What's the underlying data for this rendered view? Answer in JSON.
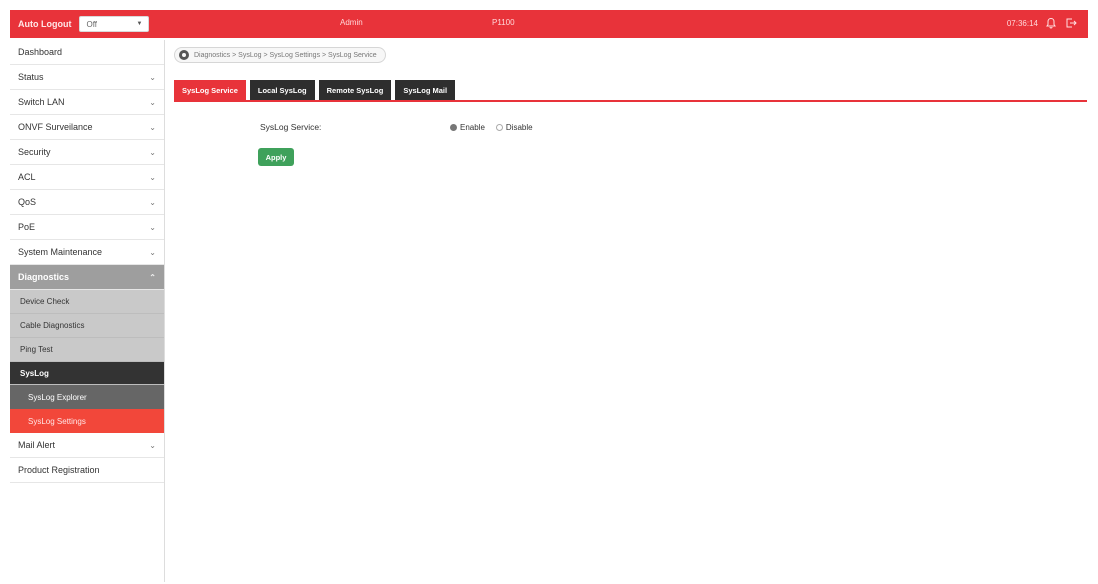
{
  "header": {
    "auto_logout_label": "Auto Logout",
    "auto_logout_value": "Off",
    "user_name": "Admin",
    "model_name": "P1100",
    "clock": "07:36:14",
    "icons": [
      "bell-icon",
      "logout-icon"
    ]
  },
  "sidebar": {
    "items": [
      {
        "label": "Dashboard"
      },
      {
        "label": "Status"
      },
      {
        "label": "Switch LAN"
      },
      {
        "label": "ONVF Surveilance"
      },
      {
        "label": "Security"
      },
      {
        "label": "ACL"
      },
      {
        "label": "QoS"
      },
      {
        "label": "PoE"
      },
      {
        "label": "System Maintenance"
      },
      {
        "label": "Diagnostics"
      },
      {
        "label": "Mail Alert"
      },
      {
        "label": "Product Registration"
      }
    ],
    "diagnostics_children": [
      {
        "label": "Device Check"
      },
      {
        "label": "Cable Diagnostics"
      },
      {
        "label": "Ping Test"
      },
      {
        "label": "SysLog"
      }
    ],
    "syslog_children": [
      {
        "label": "SysLog Explorer"
      },
      {
        "label": "SysLog Settings"
      }
    ]
  },
  "breadcrumb": {
    "text": "Diagnostics > SysLog > SysLog Settings > SysLog Service"
  },
  "tabs": [
    {
      "label": "SysLog Service"
    },
    {
      "label": "Local SysLog"
    },
    {
      "label": "Remote SysLog"
    },
    {
      "label": "SysLog Mail"
    }
  ],
  "form": {
    "label": "SysLog Service:",
    "option_enable": "Enable",
    "option_disable": "Disable",
    "selected": "Enable",
    "apply_label": "Apply"
  },
  "colors": {
    "accent": "#e8333a",
    "apply": "#3fa15b",
    "selected_menu": "#f2473a"
  }
}
